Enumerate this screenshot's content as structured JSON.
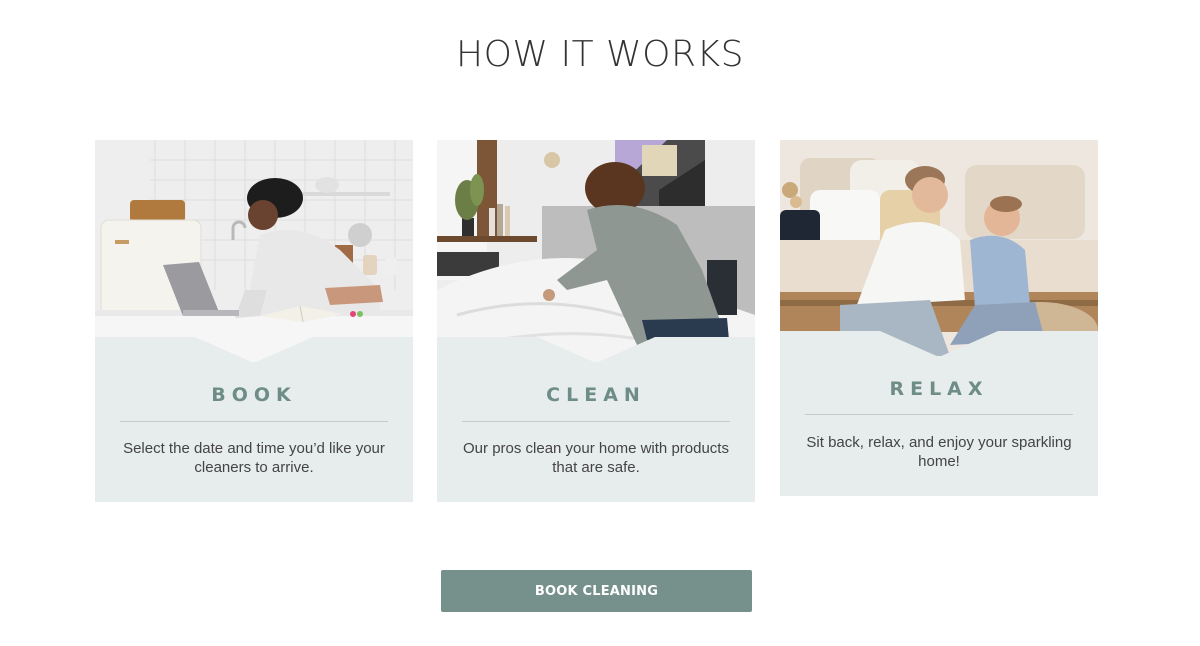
{
  "section": {
    "title": "HOW IT WORKS"
  },
  "steps": [
    {
      "heading": "BOOK",
      "text": "Select the date and time you’d like your cleaners to arrive.",
      "photo_icon": "woman-laptop-kitchen-photo"
    },
    {
      "heading": "CLEAN",
      "text": "Our pros clean your home with products that are safe.",
      "photo_icon": "woman-making-bed-photo"
    },
    {
      "heading": "RELAX",
      "text": "Sit back, relax, and enjoy your sparkling home!",
      "photo_icon": "mother-child-sofa-photo"
    }
  ],
  "cta": {
    "label": "BOOK CLEANING"
  },
  "colors": {
    "accent": "#76918b",
    "heading": "#6e8d87",
    "card_bg": "#e7ecec"
  }
}
